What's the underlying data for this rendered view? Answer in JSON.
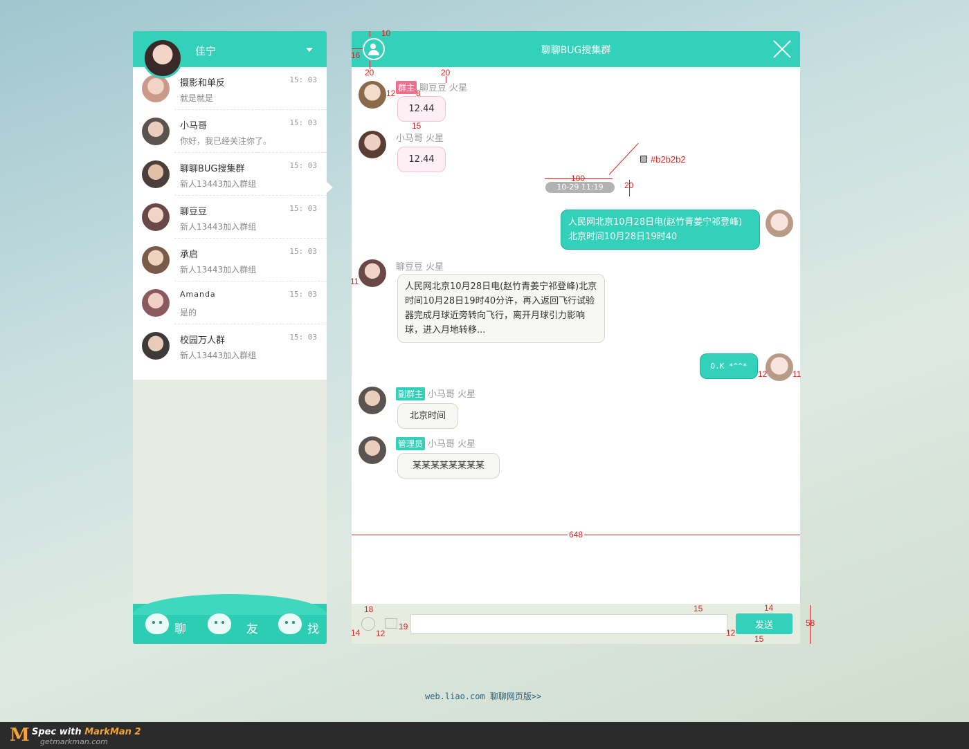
{
  "sidebar": {
    "user_name": "佳宁",
    "conversations": [
      {
        "name": "摄影和单反",
        "message": "就是就是",
        "time": "15: 03",
        "color": "#c99a8a"
      },
      {
        "name": "小马哥",
        "message": "你好，我已经关注你了。",
        "time": "15: 03",
        "color": "#5b5350"
      },
      {
        "name": "聊聊BUG搜集群",
        "message": "新人13443加入群组",
        "time": "15: 03",
        "color": "#4a3f3a"
      },
      {
        "name": "聊豆豆",
        "message": "新人13443加入群组",
        "time": "15: 03",
        "color": "#6b4848"
      },
      {
        "name": "承启",
        "message": "新人13443加入群组",
        "time": "15: 03",
        "color": "#7a5a48"
      },
      {
        "name": "Amanda",
        "message": "是的",
        "time": "15: 03",
        "color": "#8a5a5e"
      },
      {
        "name": "校园万人群",
        "message": "新人13443加入群组",
        "time": "15: 03",
        "color": "#3e3a3a"
      }
    ],
    "footer_tabs": [
      "聊",
      "友",
      "找"
    ]
  },
  "chat": {
    "title": "聊聊BUG搜集群",
    "timestamp": "10-29 11:19",
    "messages": {
      "m1": {
        "badge": "群主",
        "sender": "聊豆豆 火星",
        "text": "12.44"
      },
      "m2": {
        "sender": "小马哥 火星",
        "text": "12.44"
      },
      "m3": {
        "text_line1": "人民网北京10月28日电(赵竹青姜宁祁登峰)",
        "text_line2": "北京时间10月28日19时40"
      },
      "m4": {
        "sender": "聊豆豆 火星",
        "text": "人民网北京10月28日电(赵竹青姜宁祁登峰)北京时间10月28日19时40分许，再入返回飞行试验器完成月球近旁转向飞行，离开月球引力影响球，进入月地转移..."
      },
      "m5": {
        "text": "O.K *^^*"
      },
      "m6": {
        "badge": "副群主",
        "sender": "小马哥 火星",
        "text": "北京时间"
      },
      "m7": {
        "badge": "管理员",
        "sender": "小马哥 火星",
        "text": "某某某某某某某某"
      }
    },
    "send_label": "发送"
  },
  "spec": {
    "time_color_label": "#b2b2b2",
    "n10": "10",
    "n16": "16",
    "n20a": "20",
    "n20b": "20",
    "n12a": "12",
    "n8": "8",
    "n15a": "15",
    "n100": "100",
    "n20c": "20",
    "n11a": "11",
    "n12b": "12",
    "n11b": "11",
    "n648": "648",
    "n18": "18",
    "n14a": "14",
    "n12c": "12",
    "n19": "19",
    "n15b": "15",
    "n12d": "12",
    "n14b": "14",
    "n15c": "15",
    "n58": "58"
  },
  "footer": {
    "link": "web.liao.com 聊聊网页版>>"
  },
  "markman": {
    "title_prefix": "Spec with ",
    "title_brand": "MarkMan 2",
    "url": "getmarkman.com"
  },
  "colors": {
    "accent": "#33d1b9",
    "time_pill": "#b2b2b2",
    "badge_owner": "#f06f8c",
    "badge_admin": "#33d1b9"
  }
}
